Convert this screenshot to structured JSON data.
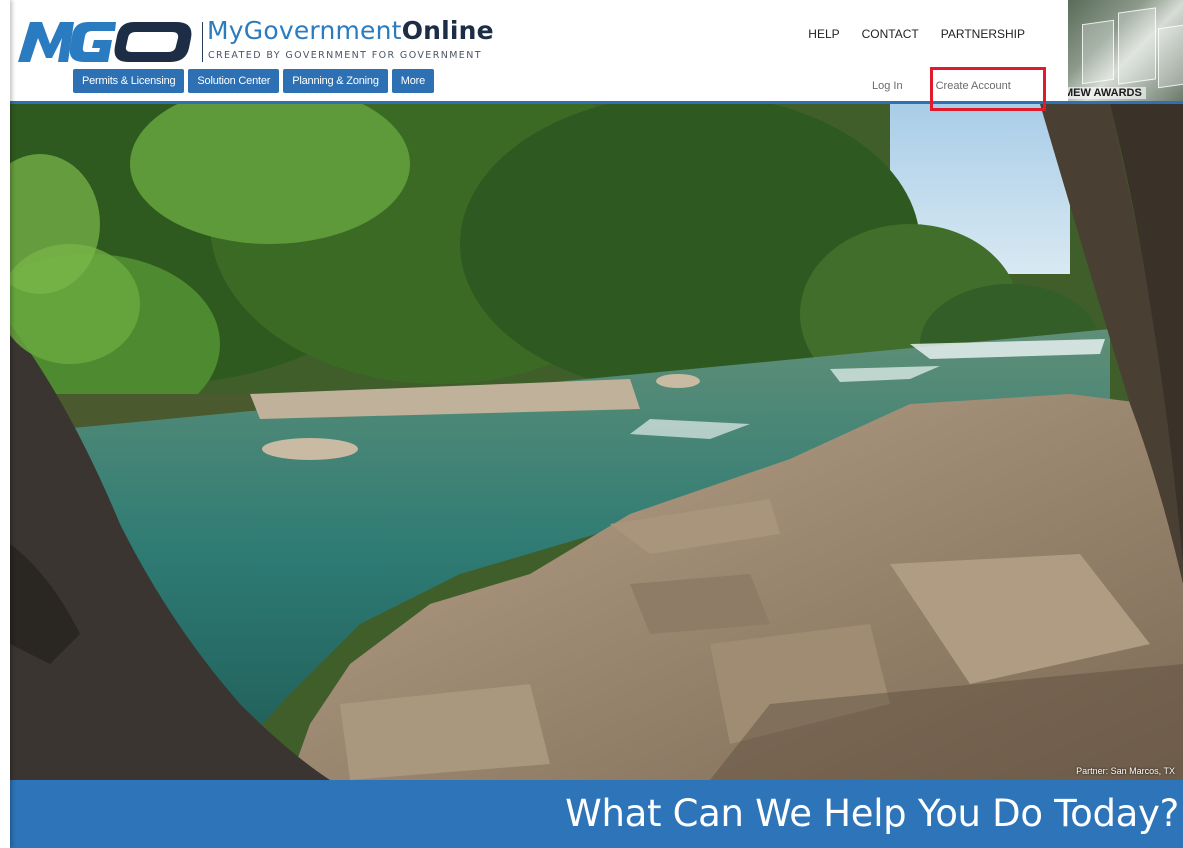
{
  "brand": {
    "logo_mark": "MGO",
    "name_light": "MyGovernment",
    "name_bold": "Online",
    "tagline": "CREATED BY GOVERNMENT FOR GOVERNMENT"
  },
  "topnav": {
    "help": "HELP",
    "contact": "CONTACT",
    "partnership": "PARTNERSHIP"
  },
  "awards": {
    "label": "MEW AWARDS"
  },
  "subnav": {
    "items": [
      "Permits & Licensing",
      "Solution Center",
      "Planning & Zoning",
      "More"
    ]
  },
  "auth": {
    "login": "Log In",
    "create_account": "Create Account"
  },
  "hero": {
    "caption": "Partner: San Marcos, TX"
  },
  "band": {
    "title": "What Can We Help You Do Today?"
  },
  "colors": {
    "brand_blue": "#2d70b3",
    "band_blue": "#2d74b8",
    "highlight_red": "#e01b2d",
    "logo_navy": "#1c2d45"
  }
}
